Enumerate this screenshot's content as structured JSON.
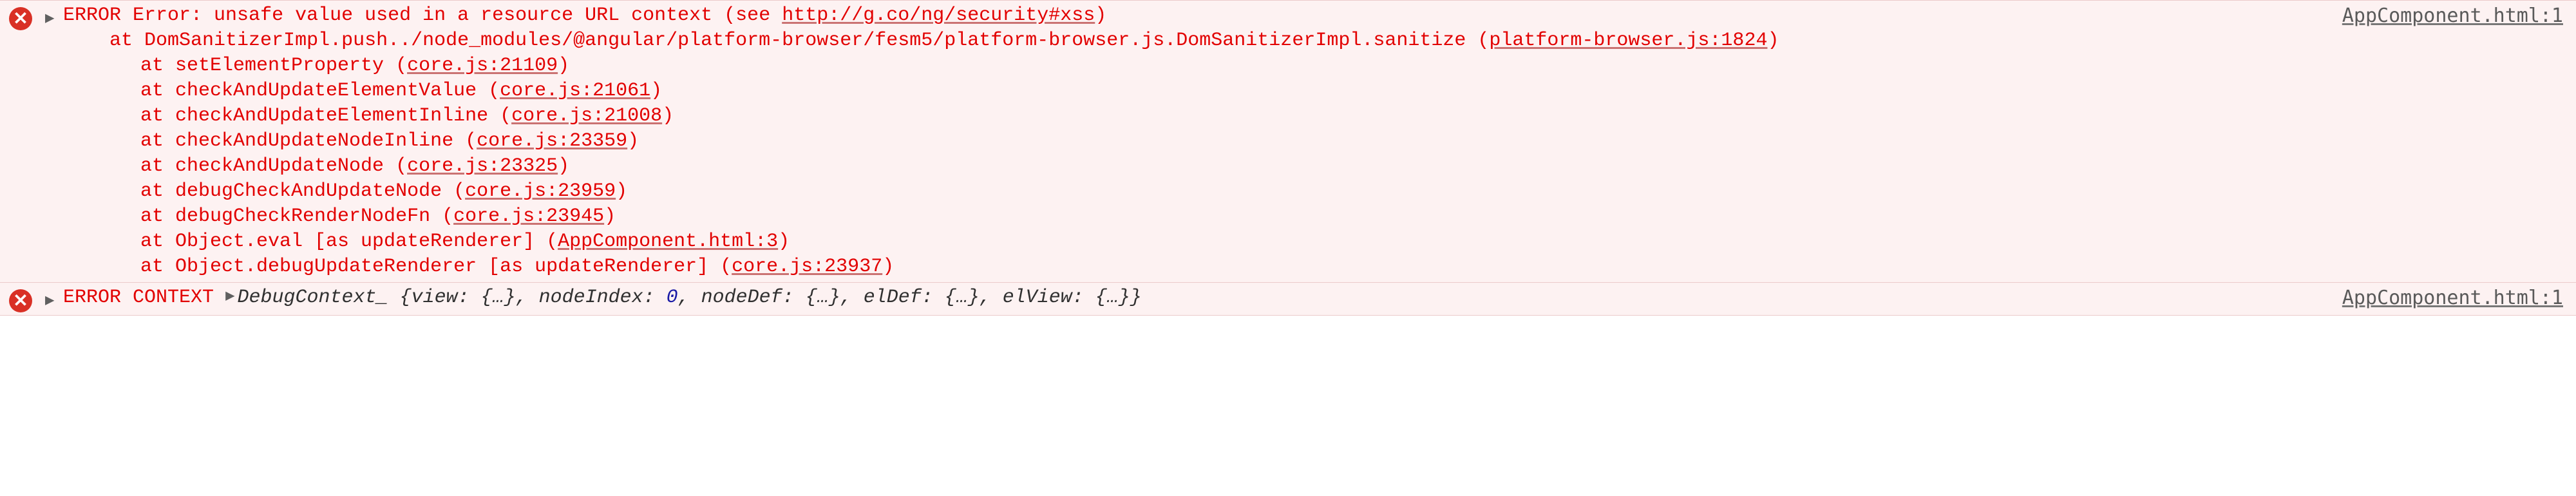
{
  "entries": [
    {
      "type": "error",
      "source": "AppComponent.html:1",
      "header_prefix": "ERROR",
      "header_label": "Error: unsafe value used in a resource URL context (see ",
      "header_link": "http://g.co/ng/security#xss",
      "header_suffix": ")",
      "wrap_prefix": "    at DomSanitizerImpl.push../node_modules/@angular/platform-browser/fesm5/platform-browser.js.DomSanitizerImpl.sanitize (",
      "wrap_link": "platform-browser.js:1824",
      "wrap_suffix": ")",
      "stack": [
        {
          "pre": "at setElementProperty (",
          "link": "core.js:21109",
          "post": ")"
        },
        {
          "pre": "at checkAndUpdateElementValue (",
          "link": "core.js:21061",
          "post": ")"
        },
        {
          "pre": "at checkAndUpdateElementInline (",
          "link": "core.js:21008",
          "post": ")"
        },
        {
          "pre": "at checkAndUpdateNodeInline (",
          "link": "core.js:23359",
          "post": ")"
        },
        {
          "pre": "at checkAndUpdateNode (",
          "link": "core.js:23325",
          "post": ")"
        },
        {
          "pre": "at debugCheckAndUpdateNode (",
          "link": "core.js:23959",
          "post": ")"
        },
        {
          "pre": "at debugCheckRenderNodeFn (",
          "link": "core.js:23945",
          "post": ")"
        },
        {
          "pre": "at Object.eval [as updateRenderer] (",
          "link": "AppComponent.html:3",
          "post": ")"
        },
        {
          "pre": "at Object.debugUpdateRenderer [as updateRenderer] (",
          "link": "core.js:23937",
          "post": ")"
        }
      ]
    },
    {
      "type": "error-context",
      "source": "AppComponent.html:1",
      "label": "ERROR CONTEXT",
      "obj_name": "DebugContext_",
      "obj_body_prefix": " {view: {…}, nodeIndex: ",
      "obj_num": "0",
      "obj_body_suffix": ", nodeDef: {…}, elDef: {…}, elView: {…}}"
    }
  ]
}
